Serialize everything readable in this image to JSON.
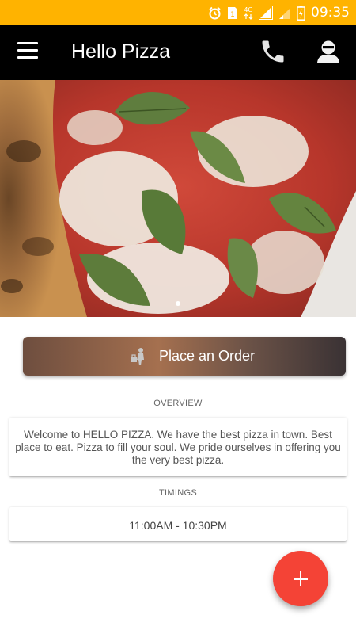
{
  "status_bar": {
    "time": "09:35",
    "icons": [
      "alarm-icon",
      "sim1-icon",
      "network-4g-icon",
      "signal-icon",
      "signal-weak-icon",
      "battery-charging-icon"
    ],
    "color": "#ffb300"
  },
  "app_bar": {
    "title": "Hello Pizza",
    "icons": [
      "menu-icon",
      "phone-icon",
      "user-icon"
    ]
  },
  "hero": {
    "image": "margherita-pizza-slice-photo",
    "slide_count": 2,
    "active_slide": 1
  },
  "order_button": {
    "label": "Place an Order",
    "icon": "delivery-person-icon"
  },
  "overview": {
    "heading": "OVERVIEW",
    "text": "Welcome to HELLO PIZZA. We have the best pizza in town. Best place to eat. Pizza to fill your soul. We pride ourselves in offering you the very best pizza."
  },
  "timings": {
    "heading": "TIMINGS",
    "hours": "11:00AM - 10:30PM"
  },
  "fab": {
    "icon": "plus-icon",
    "color": "#f44336"
  }
}
